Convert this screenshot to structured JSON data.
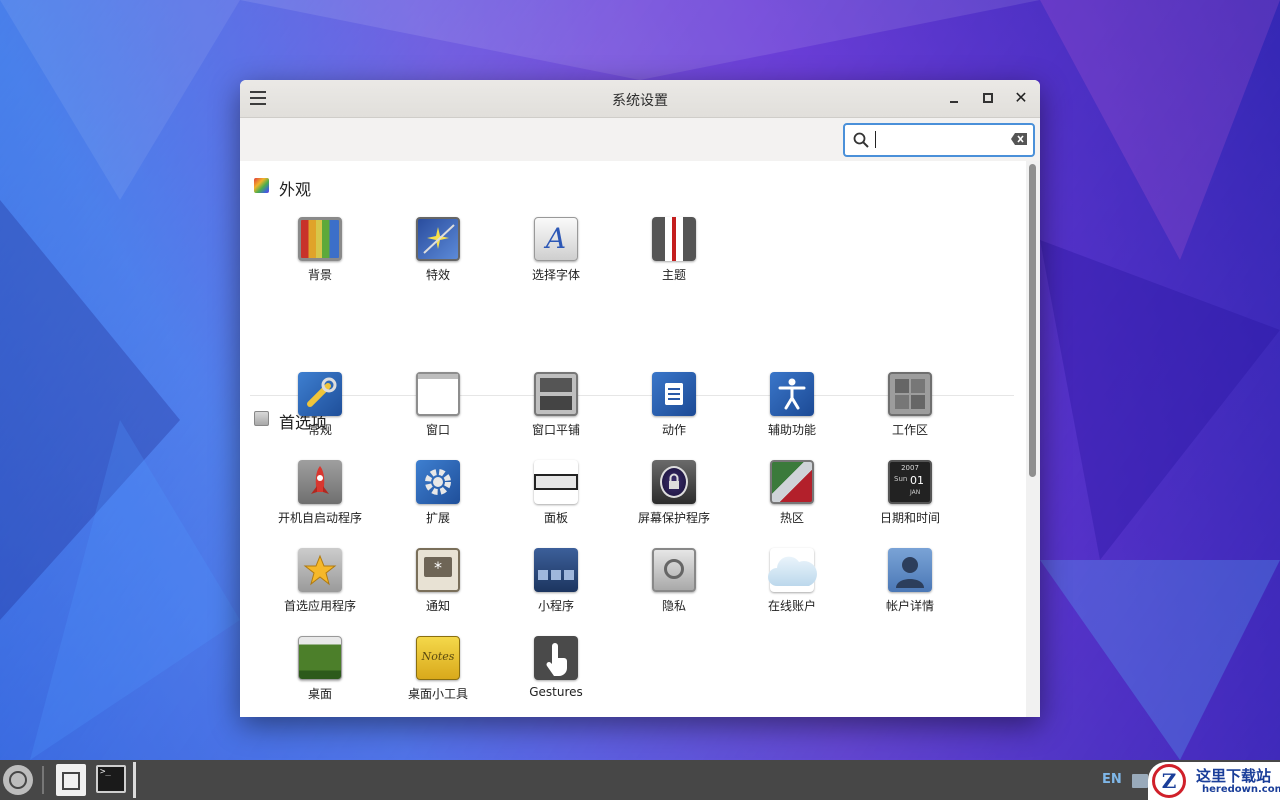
{
  "window": {
    "title": "系统设置",
    "search": {
      "placeholder": "",
      "value": ""
    }
  },
  "sections": [
    {
      "title": "外观",
      "items": [
        "背景",
        "特效",
        "选择字体",
        "主题"
      ]
    },
    {
      "title": "首选项",
      "items": [
        "常规",
        "窗口",
        "窗口平铺",
        "动作",
        "辅助功能",
        "工作区",
        "开机自启动程序",
        "扩展",
        "面板",
        "屏幕保护程序",
        "热区",
        "日期和时间",
        "首选应用程序",
        "通知",
        "小程序",
        "隐私",
        "在线账户",
        "帐户详情",
        "桌面",
        "桌面小工具",
        "Gestures"
      ]
    }
  ],
  "icons": {
    "date": {
      "year": "2007",
      "day_name": "Sun",
      "day": "01",
      "month": "JAN"
    },
    "desklet": "Notes"
  },
  "taskbar": {
    "language": "EN"
  },
  "watermark": {
    "title": "这里下载站",
    "url": "heredown.com",
    "logo_letter": "Z"
  },
  "colors": {
    "accent": "#4a90d9",
    "taskbar": "#474747"
  }
}
